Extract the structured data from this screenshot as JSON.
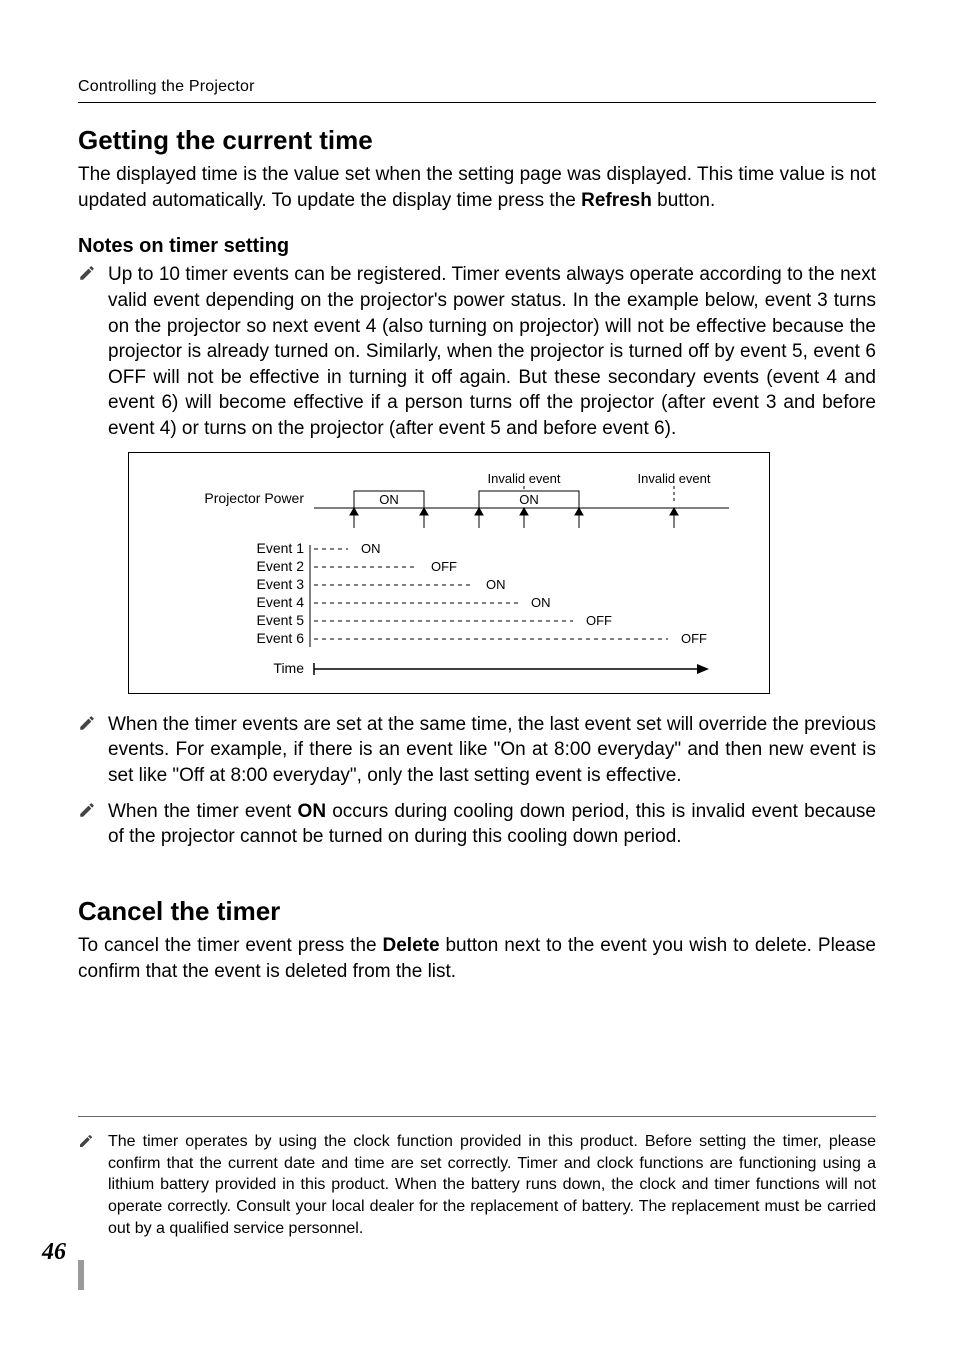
{
  "running_head": "Controlling the Projector",
  "section1": {
    "title": "Getting the current time",
    "body_pre": "The displayed time is the value set when the setting page was displayed. This time value is not updated automatically. To update the display time press the ",
    "body_kw": "Refresh",
    "body_post": " button."
  },
  "subhead": "Notes on timer setting",
  "notes_main": {
    "n1": "Up to 10 timer events can be registered. Timer events always operate according to the next valid event depending on the projector's power status. In the example below, event 3 turns on the projector so next event 4 (also turning on projector) will not be effective because the projector is already turned on. Similarly, when the projector is turned off by event 5, event 6 OFF will not be effective in turning it off again. But these secondary events (event 4 and event 6) will become effective if a person turns off the projector (after event 3 and before event 4) or turns on the projector (after event 5 and before event 6).",
    "n2": "When the timer events are set at the same time, the last event set will override the previous events. For example, if there is an event like \"On at 8:00 everyday\" and then new event is set like \"Off at 8:00 everyday\", only the last setting event is effective.",
    "n3_pre": "When the timer event ",
    "n3_kw": "ON",
    "n3_post": " occurs during cooling down period, this is invalid event because of the projector cannot be turned on during this cooling down period."
  },
  "section2": {
    "title": "Cancel the timer",
    "body_pre": "To cancel the timer event press the ",
    "body_kw": "Delete",
    "body_post": " button next to the event you wish to delete. Please confirm that the event is deleted from the list."
  },
  "footer_note": "The timer operates by using the clock function provided in this product. Before setting the timer, please confirm that the current date and time are set correctly. Timer and clock functions are functioning using a lithium battery provided in this product. When the battery runs down, the clock and timer functions will not operate correctly. Consult your local dealer for the replacement of battery. The replacement must be carried out by a qualified service personnel.",
  "page_number": "46",
  "diagram": {
    "labels": {
      "projector_power": "Projector Power",
      "time": "Time",
      "invalid_event": "Invalid event",
      "events": [
        "Event 1",
        "Event 2",
        "Event 3",
        "Event 4",
        "Event 5",
        "Event 6"
      ],
      "on": "ON",
      "off": "OFF"
    }
  },
  "chart_data": {
    "type": "timeline",
    "title": "Projector Power state over timer events",
    "xlabel": "Time",
    "ylabel": "",
    "timeline_segments": [
      {
        "state": "OFF",
        "from_event": null,
        "to_event": "Event 1"
      },
      {
        "state": "ON",
        "from_event": "Event 1",
        "to_event": "Event 2"
      },
      {
        "state": "OFF",
        "from_event": "Event 2",
        "to_event": "Event 3"
      },
      {
        "state": "ON",
        "from_event": "Event 3",
        "to_event": "Event 5"
      },
      {
        "state": "OFF",
        "from_event": "Event 5",
        "to_event": "Event 6+"
      }
    ],
    "events": [
      {
        "name": "Event 1",
        "action": "ON",
        "effective": true,
        "x": 1
      },
      {
        "name": "Event 2",
        "action": "OFF",
        "effective": true,
        "x": 2
      },
      {
        "name": "Event 3",
        "action": "ON",
        "effective": true,
        "x": 3
      },
      {
        "name": "Event 4",
        "action": "ON",
        "effective": false,
        "x": 4,
        "note": "Invalid event"
      },
      {
        "name": "Event 5",
        "action": "OFF",
        "effective": true,
        "x": 5
      },
      {
        "name": "Event 6",
        "action": "OFF",
        "effective": false,
        "x": 6,
        "note": "Invalid event"
      }
    ]
  }
}
